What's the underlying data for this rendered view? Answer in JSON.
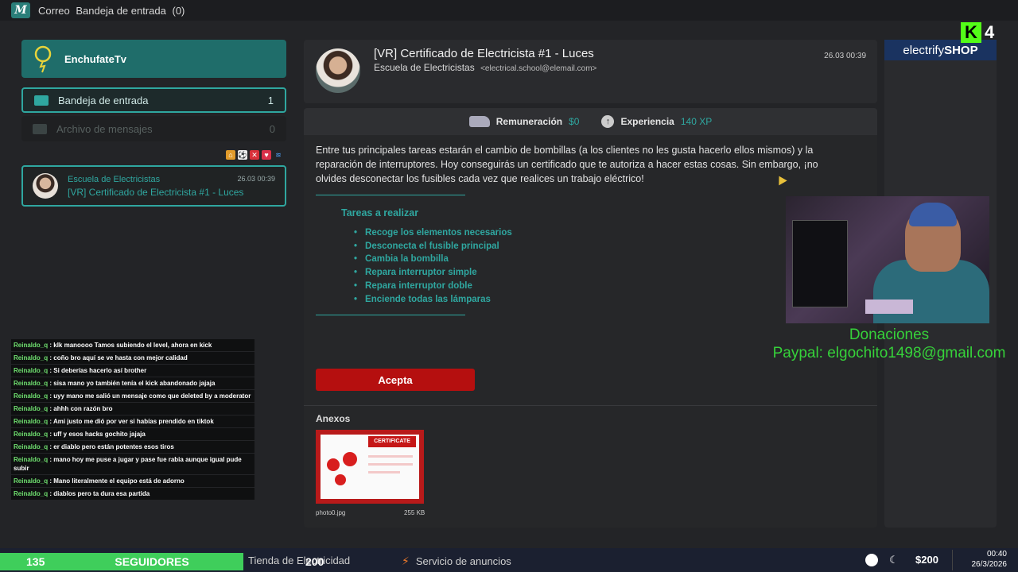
{
  "app": {
    "title_prefix": "Correo",
    "folder_title": "Bandeja de entrada",
    "folder_count": "(0)"
  },
  "sidebar": {
    "brand": "EnchufateTv",
    "folders": [
      {
        "label": "Bandeja de entrada",
        "count": "1"
      },
      {
        "label": "Archivo de mensajes",
        "count": "0"
      }
    ],
    "message": {
      "sender": "Escuela de Electricistas",
      "date": "26.03 00:39",
      "subject": "[VR] Certificado de Electricista #1 - Luces"
    }
  },
  "email": {
    "subject": "[VR] Certificado de Electricista #1 - Luces",
    "sender_name": "Escuela de Electricistas",
    "sender_email": "<electrical.school@elemail.com>",
    "date": "26.03 00:39",
    "reward_label": "Remuneración",
    "reward_value": "$0",
    "xp_label": "Experiencia",
    "xp_value": "140 XP",
    "body": "Entre tus principales tareas estarán el cambio de bombillas (a los clientes no les gusta hacerlo ellos mismos) y la reparación de interruptores. Hoy conseguirás un certificado que te autoriza a hacer estas cosas. Sin embargo, ¡no olvides desconectar los fusibles cada vez que realices un trabajo eléctrico!",
    "tasks_title": "Tareas a realizar",
    "tasks": [
      "Recoge los elementos necesarios",
      "Desconecta el fusible principal",
      "Cambia la bombilla",
      "Repara interruptor simple",
      "Repara interruptor doble",
      "Enciende todas las lámparas"
    ],
    "accept_label": "Acepta",
    "attachments_title": "Anexos",
    "attachment": {
      "name": "photo0.jpg",
      "size": "255 KB",
      "thumb_title": "CERTIFICATE"
    }
  },
  "shop": {
    "brand_light": "electrify",
    "brand_bold": "SHOP"
  },
  "stream": {
    "kick_letter": "K",
    "kick_number": "4",
    "donations_title": "Donaciones",
    "donations_paypal": "Paypal: elgochito1498@gmail.com",
    "followers_count": "135",
    "followers_label": "SEGUIDORES",
    "overlay_number": "200",
    "chat": [
      {
        "user": "Reinaldo_q",
        "text": ": klk manoooo Tamos subiendo el level, ahora en kick"
      },
      {
        "user": "Reinaldo_q",
        "text": ": coño bro aquí se ve hasta con mejor calidad"
      },
      {
        "user": "Reinaldo_q",
        "text": ": Si deberías hacerlo así brother"
      },
      {
        "user": "Reinaldo_q",
        "text": ": sisa mano yo también tenía el kick abandonado jajaja"
      },
      {
        "user": "Reinaldo_q",
        "text": ": uyy mano me salió un mensaje como que deleted by a moderator"
      },
      {
        "user": "Reinaldo_q",
        "text": ": ahhh con razón bro"
      },
      {
        "user": "Reinaldo_q",
        "text": ": Ami justo me dió por ver si habías prendido en tiktok"
      },
      {
        "user": "Reinaldo_q",
        "text": ": uff y esos hacks gochito jajaja"
      },
      {
        "user": "Reinaldo_q",
        "text": ": er diablo pero están potentes esos tiros"
      },
      {
        "user": "Reinaldo_q",
        "text": ": mano hoy me puse a jugar y pase fue rabia aunque igual pude subir"
      },
      {
        "user": "Reinaldo_q",
        "text": ": Mano literalmente el equipo está de adorno"
      },
      {
        "user": "Reinaldo_q",
        "text": ": diablos pero ta dura esa partida"
      }
    ]
  },
  "taskbar": {
    "store_label": "Tienda de Electricidad",
    "ads_label": "Servicio de anuncios",
    "money": "$200",
    "time": "00:40",
    "date": "26/3/2026"
  }
}
